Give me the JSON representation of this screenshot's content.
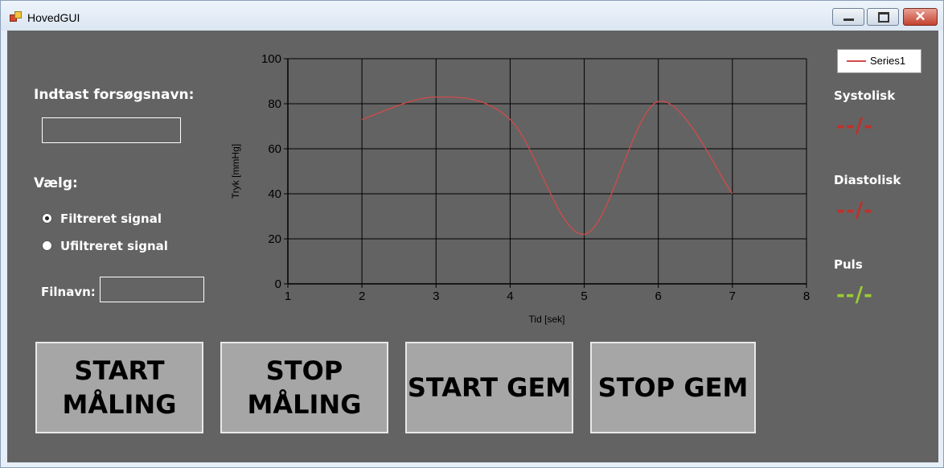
{
  "window": {
    "title": "HovedGUI"
  },
  "form": {
    "name_label": "Indtast forsøgsnavn:",
    "name_value": "",
    "choose_label": "Vælg:",
    "radio_filtered": "Filtreret signal",
    "radio_unfiltered": "Ufiltreret signal",
    "filtered_selected": true,
    "filename_label": "Filnavn:",
    "filename_value": ""
  },
  "readouts": {
    "systolic_label": "Systolisk",
    "systolic_value": "--/-",
    "diastolic_label": "Diastolisk",
    "diastolic_value": "--/-",
    "pulse_label": "Puls",
    "pulse_value": "--/-",
    "value_color": "#c0302a",
    "pulse_color": "#9acd32"
  },
  "buttons": {
    "start_measure": "START\nMÅLING",
    "stop_measure": "STOP\nMÅLING",
    "start_save": "START GEM",
    "stop_save": "STOP GEM"
  },
  "chart_data": {
    "type": "line",
    "xlabel": "Tid [sek]",
    "ylabel": "Tryk [mmHg]",
    "xlim": [
      1,
      8
    ],
    "ylim": [
      0,
      100
    ],
    "xticks": [
      1,
      2,
      3,
      4,
      5,
      6,
      7,
      8
    ],
    "yticks": [
      0,
      20,
      40,
      60,
      80,
      100
    ],
    "grid": true,
    "legend": "top-right",
    "series": [
      {
        "name": "Series1",
        "color": "#d24a4a",
        "x": [
          2,
          3,
          4,
          5,
          6,
          7
        ],
        "y": [
          73,
          83,
          73,
          22,
          81,
          40
        ]
      }
    ]
  }
}
